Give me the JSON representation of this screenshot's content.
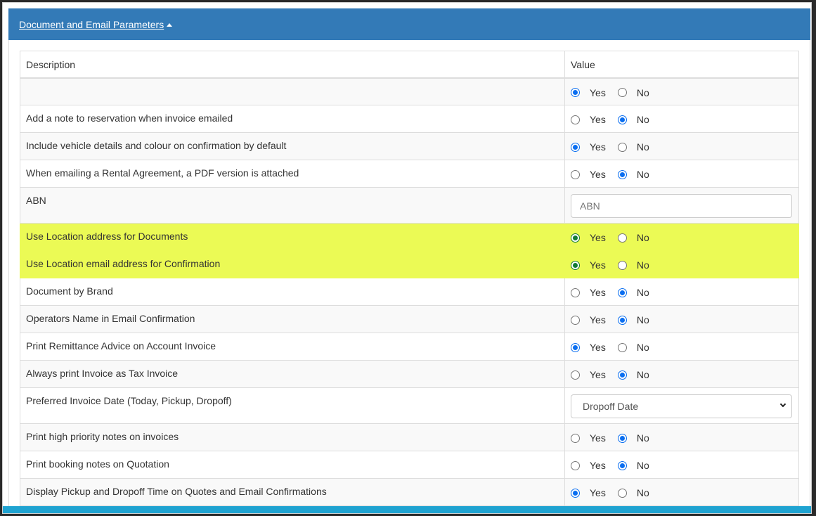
{
  "panel": {
    "title": "Document and Email Parameters"
  },
  "table": {
    "headers": {
      "description": "Description",
      "value": "Value"
    },
    "rows": [
      {
        "description": "",
        "type": "radio",
        "value": "Yes"
      },
      {
        "description": "Add a note to reservation when invoice emailed",
        "type": "radio",
        "value": "No"
      },
      {
        "description": "Include vehicle details and colour on confirmation by default",
        "type": "radio",
        "value": "Yes"
      },
      {
        "description": "When emailing a Rental Agreement, a PDF version is attached",
        "type": "radio",
        "value": "No"
      },
      {
        "description": "ABN",
        "type": "text",
        "value": "",
        "placeholder": "ABN"
      },
      {
        "description": "Use Location address for Documents",
        "type": "radio",
        "value": "Yes",
        "highlighted": true
      },
      {
        "description": "Use Location email address for Confirmation",
        "type": "radio",
        "value": "Yes",
        "highlighted": true
      },
      {
        "description": "Document by Brand",
        "type": "radio",
        "value": "No"
      },
      {
        "description": "Operators Name in Email Confirmation",
        "type": "radio",
        "value": "No"
      },
      {
        "description": "Print Remittance Advice on Account Invoice",
        "type": "radio",
        "value": "Yes"
      },
      {
        "description": "Always print Invoice as Tax Invoice",
        "type": "radio",
        "value": "No"
      },
      {
        "description": "Preferred Invoice Date (Today, Pickup, Dropoff)",
        "type": "select",
        "value": "Dropoff Date"
      },
      {
        "description": "Print high priority notes on invoices",
        "type": "radio",
        "value": "No"
      },
      {
        "description": "Print booking notes on Quotation",
        "type": "radio",
        "value": "No"
      },
      {
        "description": "Display Pickup and Dropoff Time on Quotes and Email Confirmations",
        "type": "radio",
        "value": "Yes"
      }
    ]
  },
  "labels": {
    "yes": "Yes",
    "no": "No"
  },
  "colors": {
    "header": "#337ab7",
    "highlight": "#ebfa55",
    "radio_selected": "#0a6ef0",
    "footer": "#1fa3d1"
  }
}
